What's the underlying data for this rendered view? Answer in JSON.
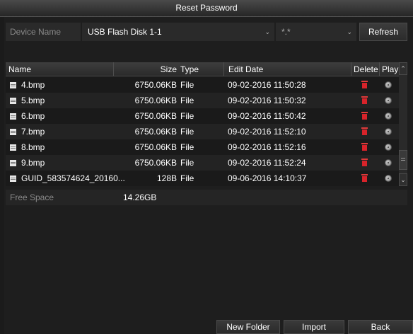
{
  "window": {
    "title": "Reset Password"
  },
  "device": {
    "label": "Device Name",
    "selected": "USB Flash Disk 1-1",
    "filter": "*.*",
    "refresh_label": "Refresh"
  },
  "table": {
    "headers": {
      "name": "Name",
      "size": "Size",
      "type": "Type",
      "edit_date": "Edit Date",
      "delete": "Delete",
      "play": "Play"
    },
    "rows": [
      {
        "name": "4.bmp",
        "size": "6750.06KB",
        "type": "File",
        "date": "09-02-2016 11:50:28"
      },
      {
        "name": "5.bmp",
        "size": "6750.06KB",
        "type": "File",
        "date": "09-02-2016 11:50:32"
      },
      {
        "name": "6.bmp",
        "size": "6750.06KB",
        "type": "File",
        "date": "09-02-2016 11:50:42"
      },
      {
        "name": "7.bmp",
        "size": "6750.06KB",
        "type": "File",
        "date": "09-02-2016 11:52:10"
      },
      {
        "name": "8.bmp",
        "size": "6750.06KB",
        "type": "File",
        "date": "09-02-2016 11:52:16"
      },
      {
        "name": "9.bmp",
        "size": "6750.06KB",
        "type": "File",
        "date": "09-02-2016 11:52:24"
      },
      {
        "name": "GUID_583574624_20160...",
        "size": "128B",
        "type": "File",
        "date": "09-06-2016 14:10:37"
      }
    ]
  },
  "storage": {
    "free_label": "Free Space",
    "free_value": "14.26GB"
  },
  "footer": {
    "new_folder": "New Folder",
    "import": "Import",
    "back": "Back"
  },
  "icons": {
    "file": "file-icon",
    "delete": "trash-icon",
    "play": "play-icon"
  },
  "colors": {
    "delete_icon": "#d8232a",
    "background": "#1b1b1b"
  }
}
